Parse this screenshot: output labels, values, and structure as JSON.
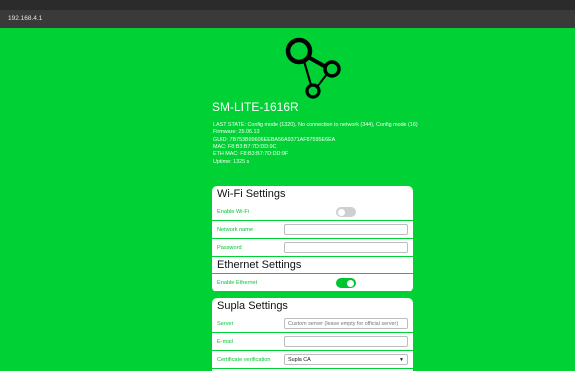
{
  "browser": {
    "address": "192.168.4.1"
  },
  "device": {
    "name": "SM-LITE-1616R",
    "info": [
      "LAST STATE: Config mode (1320), No connection to network (344), Config mode (16)",
      "Firmware: 25.06.13",
      "GUID: 7B753B99606EEBA56A9371AF87595E6EA",
      "MAC: F8:B3:B7:7D:DD:9C",
      "ETH MAC: F8:B3:B7:7D:DD:9F",
      "Uptime: 1325 s"
    ]
  },
  "wifi": {
    "title": "Wi-Fi Settings",
    "enable_label": "Enable Wi-Fi",
    "enabled": false,
    "network_label": "Network name",
    "network_value": "",
    "password_label": "Password",
    "password_value": ""
  },
  "ethernet": {
    "title": "Ethernet Settings",
    "enable_label": "Enable Ethernet",
    "enabled": true
  },
  "supla": {
    "title": "Supla Settings",
    "server_label": "Server",
    "server_placeholder": "Custom server (leave empty for official server)",
    "email_label": "E-mail",
    "email_value": "",
    "cert_label": "Certificate verification",
    "cert_value": "Supla CA"
  },
  "colors": {
    "background": "#00d134",
    "accent": "#00c532"
  },
  "icons": {
    "logo": "supla-logo-icon",
    "select": "chevron-down-icon"
  }
}
